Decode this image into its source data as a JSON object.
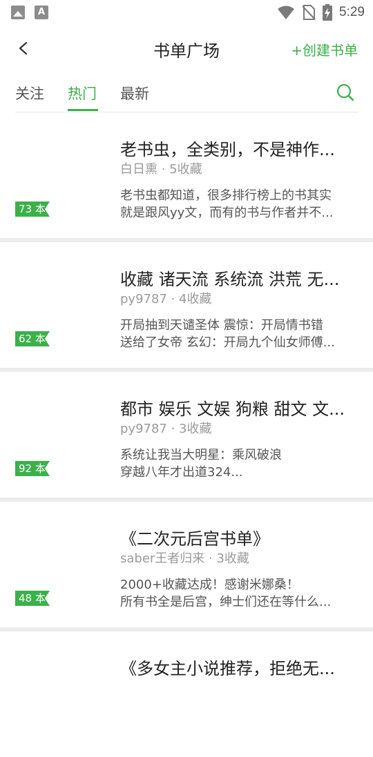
{
  "status_bar": {
    "time": "5:29",
    "notification_icons": [
      "image-icon",
      "text-icon"
    ],
    "text_icon_glyph": "A"
  },
  "header": {
    "title": "书单广场",
    "create_label": "+创建书单"
  },
  "tabs": [
    {
      "label": "关注",
      "active": false
    },
    {
      "label": "热门",
      "active": true
    },
    {
      "label": "最新",
      "active": false
    }
  ],
  "colors": {
    "accent": "#3cb04a",
    "divider": "#ececec"
  },
  "booklists": [
    {
      "count": "73 本",
      "title": "老书虫，全类别，不是神作...",
      "meta": "白日熏 · 5收藏",
      "desc1": "老书虫都知道，很多排行榜上的书其实",
      "desc2": "就是跟风yy文，而有的书与作者并不..."
    },
    {
      "count": "62 本",
      "title": "收藏 诸天流 系统流 洪荒 无...",
      "meta": "py9787 · 4收藏",
      "desc1": "开局抽到天谴圣体 震惊：开局情书错",
      "desc2": "送给了女帝 玄幻：开局九个仙女师傅..."
    },
    {
      "count": "92 本",
      "title": "都市 娱乐 文娱 狗粮 甜文 文...",
      "meta": "py9787 · 3收藏",
      "desc1": "系统让我当大明星：乘风破浪",
      "desc2": "穿越八年才出道324..."
    },
    {
      "count": "48 本",
      "title": "《二次元后宫书单》",
      "meta": "saber王者归来 · 3收藏",
      "desc1": "2000+收藏达成！感谢米娜桑！",
      "desc2": "所有书全是后宫，绅士们还在等什么..."
    },
    {
      "count": "",
      "title": "《多女主小说推荐，拒绝无...",
      "meta": "",
      "desc1": "",
      "desc2": ""
    }
  ]
}
